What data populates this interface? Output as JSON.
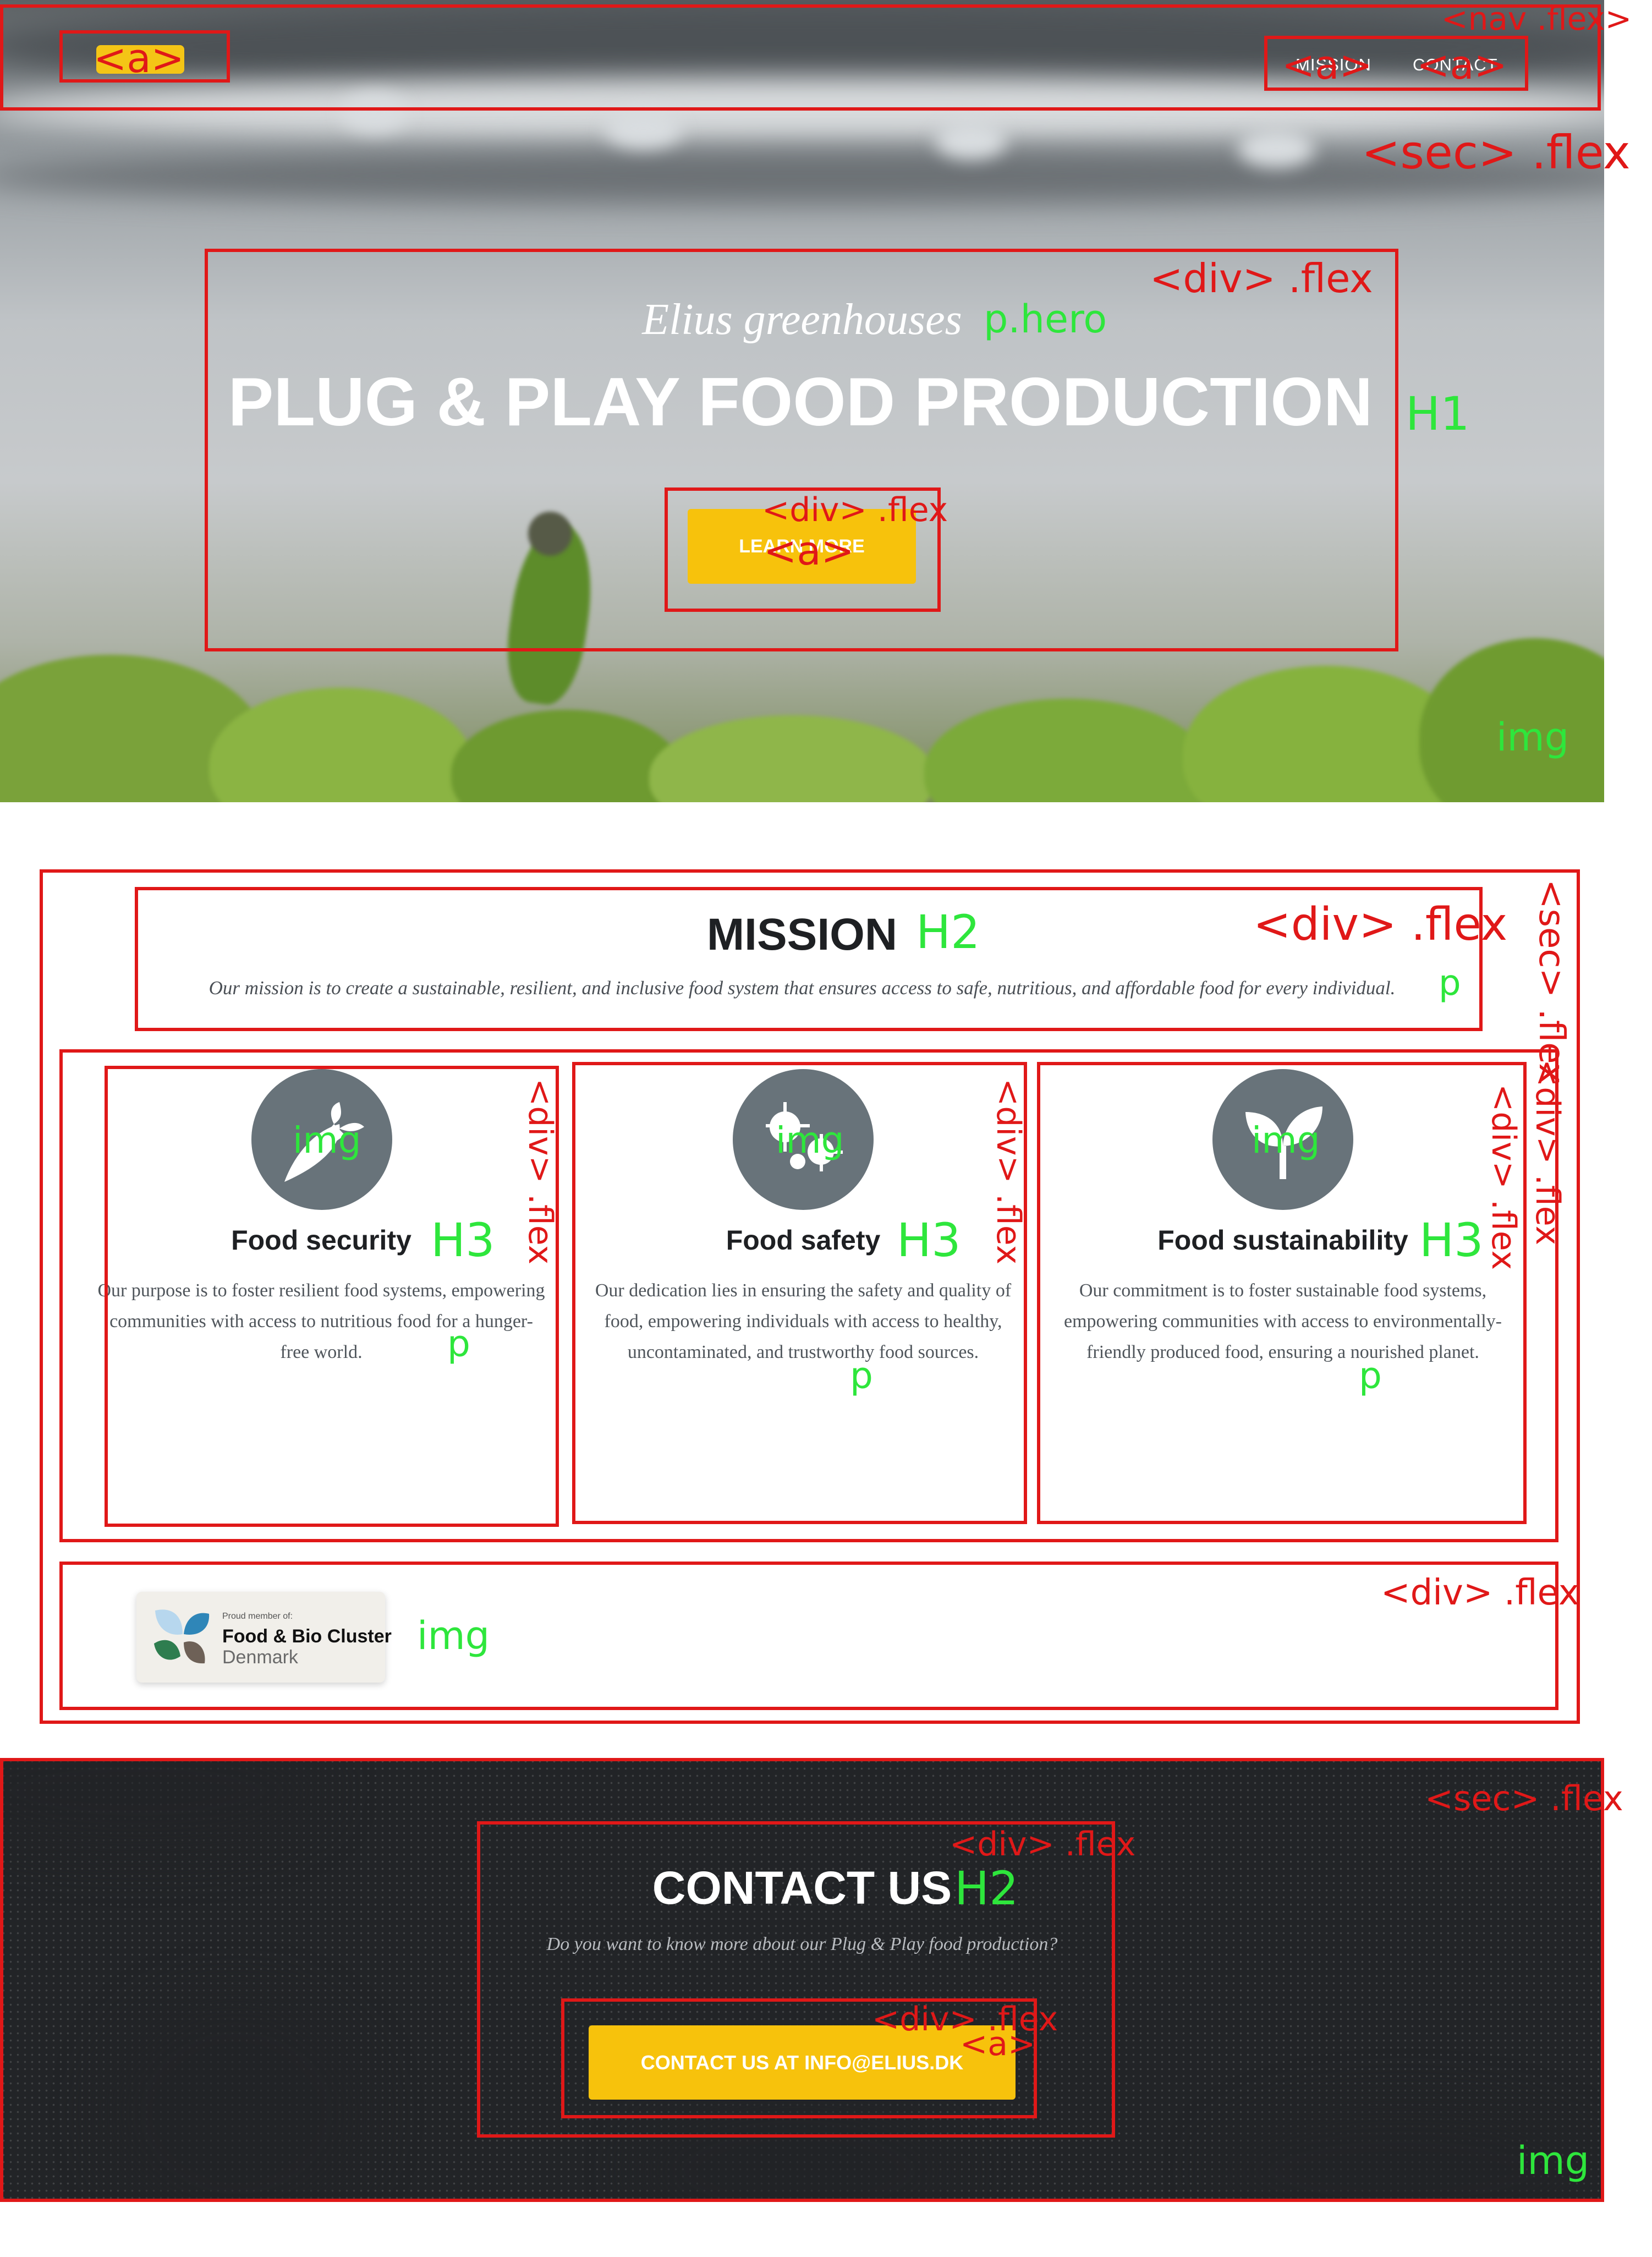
{
  "nav": {
    "links": [
      "MISSION",
      "CONTACT"
    ]
  },
  "hero": {
    "subtitle": "Elius greenhouses",
    "title": "PLUG & PLAY FOOD PRODUCTION",
    "button": "LEARN MORE"
  },
  "mission": {
    "title": "MISSION",
    "text": "Our mission is to create a sustainable, resilient, and inclusive food system that ensures access to safe, nutritious, and affordable food for every individual.",
    "cards": [
      {
        "icon": "carrot-icon",
        "title": "Food security",
        "text": "Our purpose is to foster resilient food systems, empowering communities with access to nutritious food for a hunger-free world."
      },
      {
        "icon": "bacteria-icon",
        "title": "Food safety",
        "text": "Our dedication lies in ensuring the safety and quality of food, empowering individuals with access to healthy, uncontaminated, and trustworthy food sources."
      },
      {
        "icon": "sprout-icon",
        "title": "Food sustainability",
        "text": "Our commitment is to foster sustainable food systems, empowering communities with access to environmentally-friendly produced food, ensuring a nourished planet."
      }
    ],
    "badge": {
      "small": "Proud member of:",
      "name": "Food & Bio Cluster",
      "country": "Denmark"
    }
  },
  "contact": {
    "title": "CONTACT US",
    "text": "Do you want to know more about our Plug & Play food production?",
    "button": "CONTACT US AT INFO@ELIUS.DK"
  },
  "annotations": {
    "nav": "<nav .flex>",
    "a": "<a>",
    "sec": "<sec> .flex",
    "div": "<div> .flex",
    "p_hero": "p.hero",
    "h1": "H1",
    "h2": "H2",
    "h3": "H3",
    "p": "p",
    "img": "img"
  },
  "colors": {
    "accent": "#f7c20c",
    "annotation_box": "#e01818",
    "annotation_tag": "#2ee63c",
    "dark_section": "#222427",
    "icon_circle": "#68737a"
  }
}
